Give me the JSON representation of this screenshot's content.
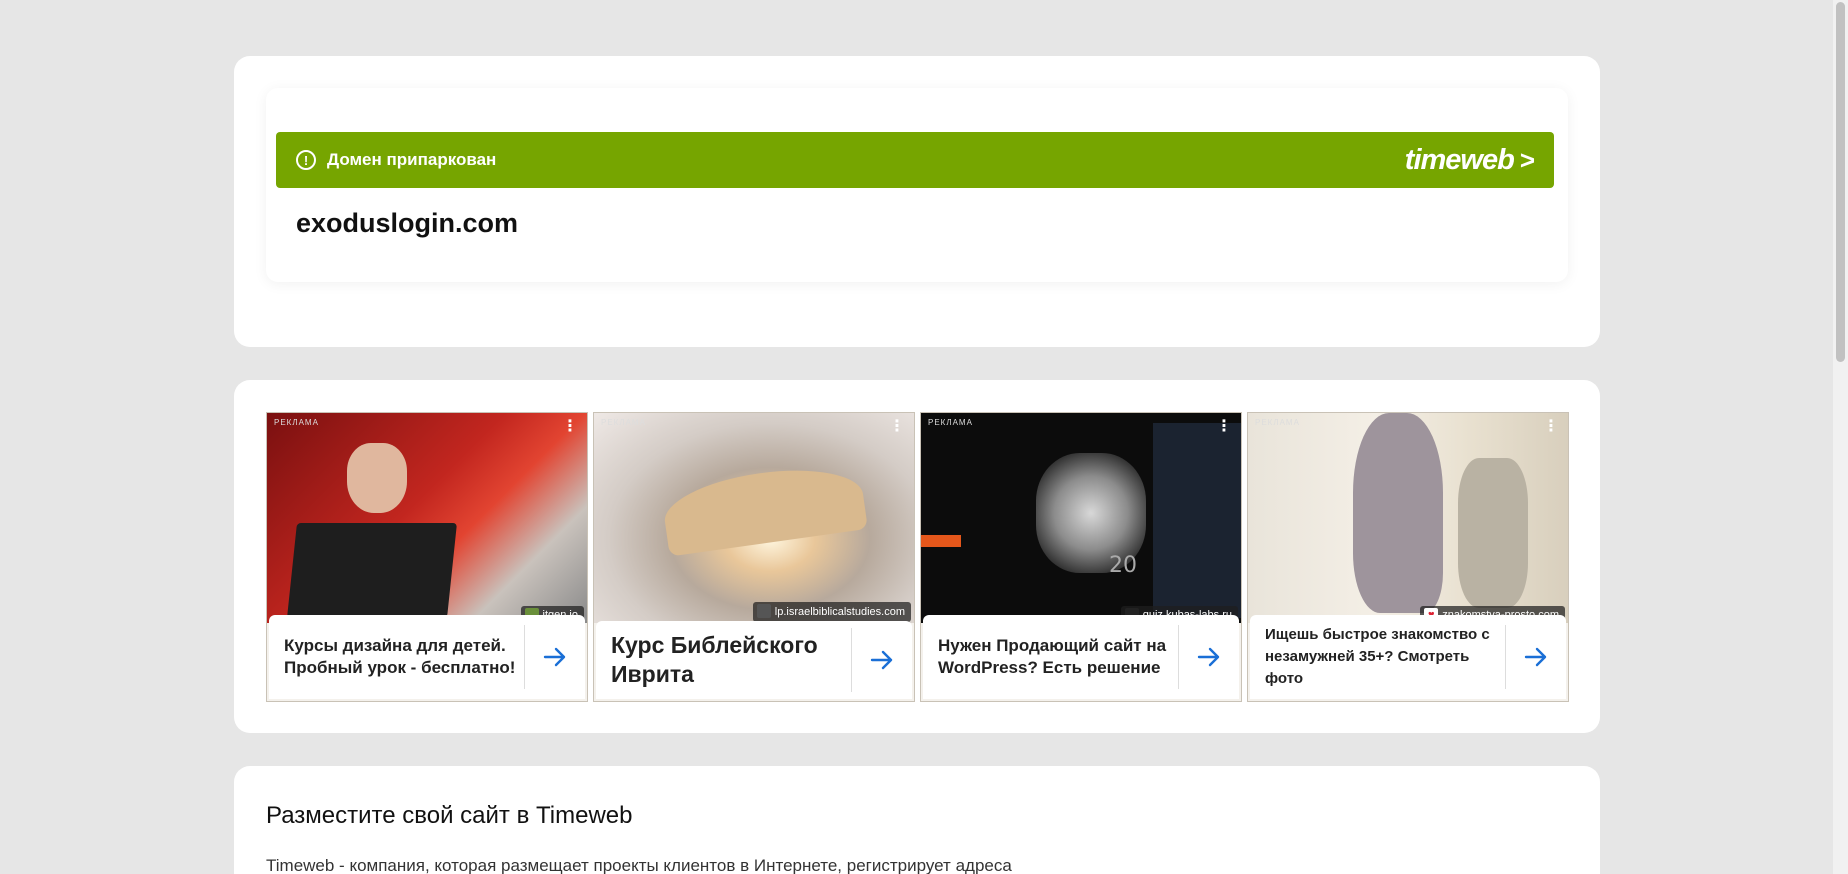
{
  "banner": {
    "notice": "Домен припаркован",
    "brand": "timeweb",
    "brand_chevron": ">"
  },
  "domain": "exoduslogin.com",
  "ads": [
    {
      "tag": "РЕКЛАМА",
      "source": "itgen.io",
      "title": "Курсы дизайна для детей. Пробный урок - бесплатно!"
    },
    {
      "tag": "РЕКЛАМА",
      "source": "lp.israelbiblicalstudies.com",
      "title": "Курс Библейского Иврита"
    },
    {
      "tag": "РЕКЛАМА",
      "source": "quiz.kubas-labs.ru",
      "title": "Нужен Продающий сайт на WordPress? Есть решение"
    },
    {
      "tag": "РЕКЛАМА",
      "source": "znakomstva-prosto.com",
      "title": "Ищешь быстрое знакомство с незамужней 35+? Смотреть фото"
    }
  ],
  "info": {
    "title": "Разместите свой сайт в Timeweb",
    "text": "Timeweb - компания, которая размещает проекты клиентов в Интернете, регистрирует адреса"
  },
  "colors": {
    "banner": "#76a500",
    "arrow": "#1a6fd6",
    "page_bg": "#e6e6e6"
  }
}
